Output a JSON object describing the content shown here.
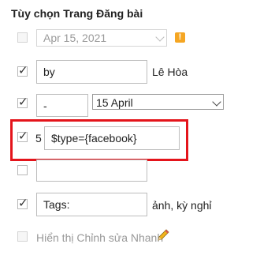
{
  "panel": {
    "title": "Tùy chọn Trang Đăng bài"
  },
  "rows": {
    "date": {
      "value": "Apr 15, 2021",
      "warning_icon": "warning-icon",
      "warning_symbol": "!"
    },
    "author": {
      "prefix_value": "by",
      "name": "Lê Hòa"
    },
    "date_format": {
      "separator_value": "-",
      "format_selected": "15 April"
    },
    "share": {
      "index": "5",
      "value": "$type={facebook}"
    },
    "empty": {
      "value": ""
    },
    "labels": {
      "prefix_value": "Tags:",
      "values": "ảnh, kỳ nghỉ"
    },
    "quick_edit": {
      "label": "Hiển thị Chỉnh sửa Nhanh",
      "icon": "pencil-icon"
    }
  },
  "colors": {
    "highlight_border": "#e4141b",
    "warning": "#f5a623"
  }
}
